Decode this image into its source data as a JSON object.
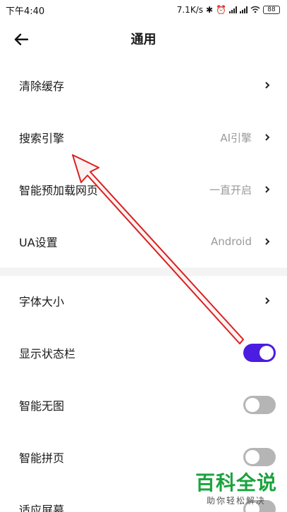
{
  "status_bar": {
    "time": "下午4:40",
    "speed": "7.1K/s",
    "battery": "88"
  },
  "header": {
    "title": "通用"
  },
  "settings": [
    {
      "label": "清除缓存",
      "value": ""
    },
    {
      "label": "搜索引擎",
      "value": "AI引擎"
    },
    {
      "label": "智能预加载网页",
      "value": "一直开启"
    },
    {
      "label": "UA设置",
      "value": "Android"
    },
    {
      "label": "字体大小",
      "value": ""
    },
    {
      "label": "显示状态栏",
      "toggle": true
    },
    {
      "label": "智能无图",
      "toggle": false
    },
    {
      "label": "智能拼页",
      "toggle": false
    },
    {
      "label": "适应屏幕",
      "toggle": false
    }
  ],
  "colors": {
    "toggle_on": "#4a1de0",
    "toggle_off": "#b5b5b5",
    "annotation_arrow": "#d9201f",
    "watermark": "#1aa33d"
  },
  "watermark": {
    "brand": "百科全说",
    "tagline": "助你轻松解决"
  }
}
